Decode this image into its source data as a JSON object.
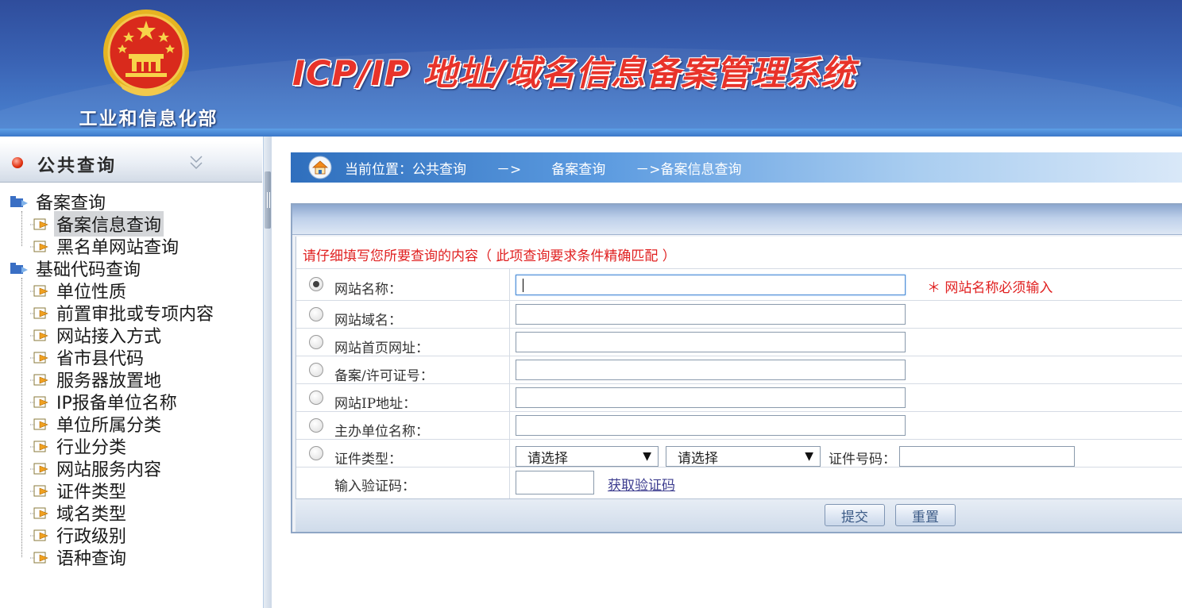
{
  "header": {
    "ministry_name": "工业和信息化部",
    "system_title": "ICP/IP 地址/域名信息备案管理系统",
    "emblem_icon": "national-emblem-icon"
  },
  "sidebar": {
    "title": "公共查询",
    "groups": [
      {
        "label": "备案查询",
        "items": [
          {
            "label": "备案信息查询",
            "selected": true
          },
          {
            "label": "黑名单网站查询",
            "selected": false
          }
        ]
      },
      {
        "label": "基础代码查询",
        "items": [
          {
            "label": "单位性质"
          },
          {
            "label": "前置审批或专项内容"
          },
          {
            "label": "网站接入方式"
          },
          {
            "label": "省市县代码"
          },
          {
            "label": "服务器放置地"
          },
          {
            "label": "IP报备单位名称"
          },
          {
            "label": "单位所属分类"
          },
          {
            "label": "行业分类"
          },
          {
            "label": "网站服务内容"
          },
          {
            "label": "证件类型"
          },
          {
            "label": "域名类型"
          },
          {
            "label": "行政级别"
          },
          {
            "label": "语种查询"
          }
        ]
      }
    ]
  },
  "breadcrumb": {
    "prefix": "当前位置：公共查询",
    "arrow": "－>",
    "item_2": "备案查询",
    "item_3": "－>备案信息查询"
  },
  "form": {
    "notice": "请仔细填写您所要查询的内容（ 此项查询要求条件精确匹配 ）",
    "fields": {
      "site_name": {
        "label": "网站名称：",
        "value": "",
        "checked": true
      },
      "site_domain": {
        "label": "网站域名：",
        "value": "",
        "checked": false
      },
      "site_homepage": {
        "label": "网站首页网址：",
        "value": "",
        "checked": false
      },
      "license_no": {
        "label": "备案/许可证号：",
        "value": "",
        "checked": false
      },
      "site_ip": {
        "label": "网站IP地址：",
        "value": "",
        "checked": false
      },
      "sponsor_name": {
        "label": "主办单位名称：",
        "value": "",
        "checked": false
      },
      "cert_type": {
        "label": "证件类型：",
        "select_1": "请选择",
        "select_2": "请选择",
        "cert_no_label": "证件号码：",
        "cert_no_value": "",
        "checked": false
      },
      "captcha": {
        "label": "输入验证码：",
        "value": "",
        "link": "获取验证码"
      }
    },
    "required_hint": "＊ 网站名称必须输入",
    "submit": "提交",
    "reset": "重置"
  },
  "colors": {
    "header_blue": "#3a63b4",
    "title_red": "#e8332a",
    "notice_red": "#e02020",
    "link_color": "#3d3d8f",
    "button_text": "#3b5a86"
  }
}
